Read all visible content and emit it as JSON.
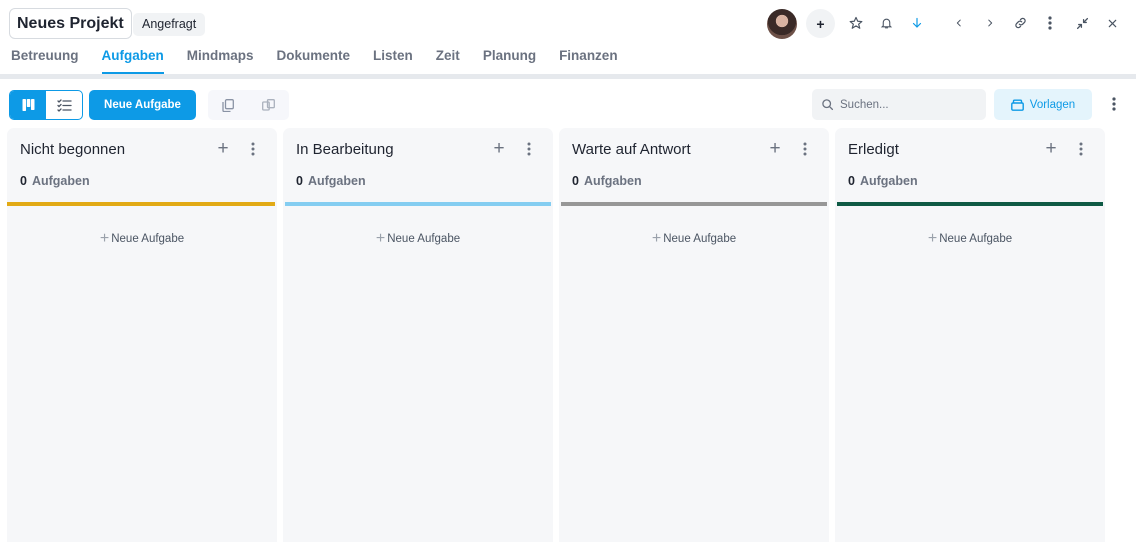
{
  "header": {
    "project_title": "Neues Projekt",
    "status": "Angefragt",
    "add_member_label": "+"
  },
  "tabs": [
    {
      "label": "Betreuung",
      "active": false
    },
    {
      "label": "Aufgaben",
      "active": true
    },
    {
      "label": "Mindmaps",
      "active": false
    },
    {
      "label": "Dokumente",
      "active": false
    },
    {
      "label": "Listen",
      "active": false
    },
    {
      "label": "Zeit",
      "active": false
    },
    {
      "label": "Planung",
      "active": false
    },
    {
      "label": "Finanzen",
      "active": false
    }
  ],
  "toolbar": {
    "new_task_label": "Neue Aufgabe",
    "search_placeholder": "Suchen...",
    "templates_label": "Vorlagen"
  },
  "columns": [
    {
      "title": "Nicht begonnen",
      "count": "0",
      "count_label": "Aufgaben",
      "color": "#e2aa15",
      "new_label": "Neue Aufgabe"
    },
    {
      "title": "In Bearbeitung",
      "count": "0",
      "count_label": "Aufgaben",
      "color": "#84cdf1",
      "new_label": "Neue Aufgabe"
    },
    {
      "title": "Warte auf Antwort",
      "count": "0",
      "count_label": "Aufgaben",
      "color": "#979797",
      "new_label": "Neue Aufgabe"
    },
    {
      "title": "Erledigt",
      "count": "0",
      "count_label": "Aufgaben",
      "color": "#0f5a45",
      "new_label": "Neue Aufgabe"
    }
  ],
  "colors": {
    "accent": "#0d9ae6",
    "divider": "#e6e9ed",
    "column_bg": "#f6f7f9"
  },
  "icons": {
    "header": [
      "star-icon",
      "bell-icon",
      "arrow-down-icon",
      "chevron-left-icon",
      "chevron-right-icon",
      "link-icon",
      "more-vertical-icon",
      "collapse-icon",
      "close-icon"
    ],
    "toolbar": [
      "kanban-icon",
      "checklist-icon",
      "copy-icon",
      "duplicate-icon",
      "search-icon",
      "template-icon",
      "more-vertical-icon"
    ]
  }
}
